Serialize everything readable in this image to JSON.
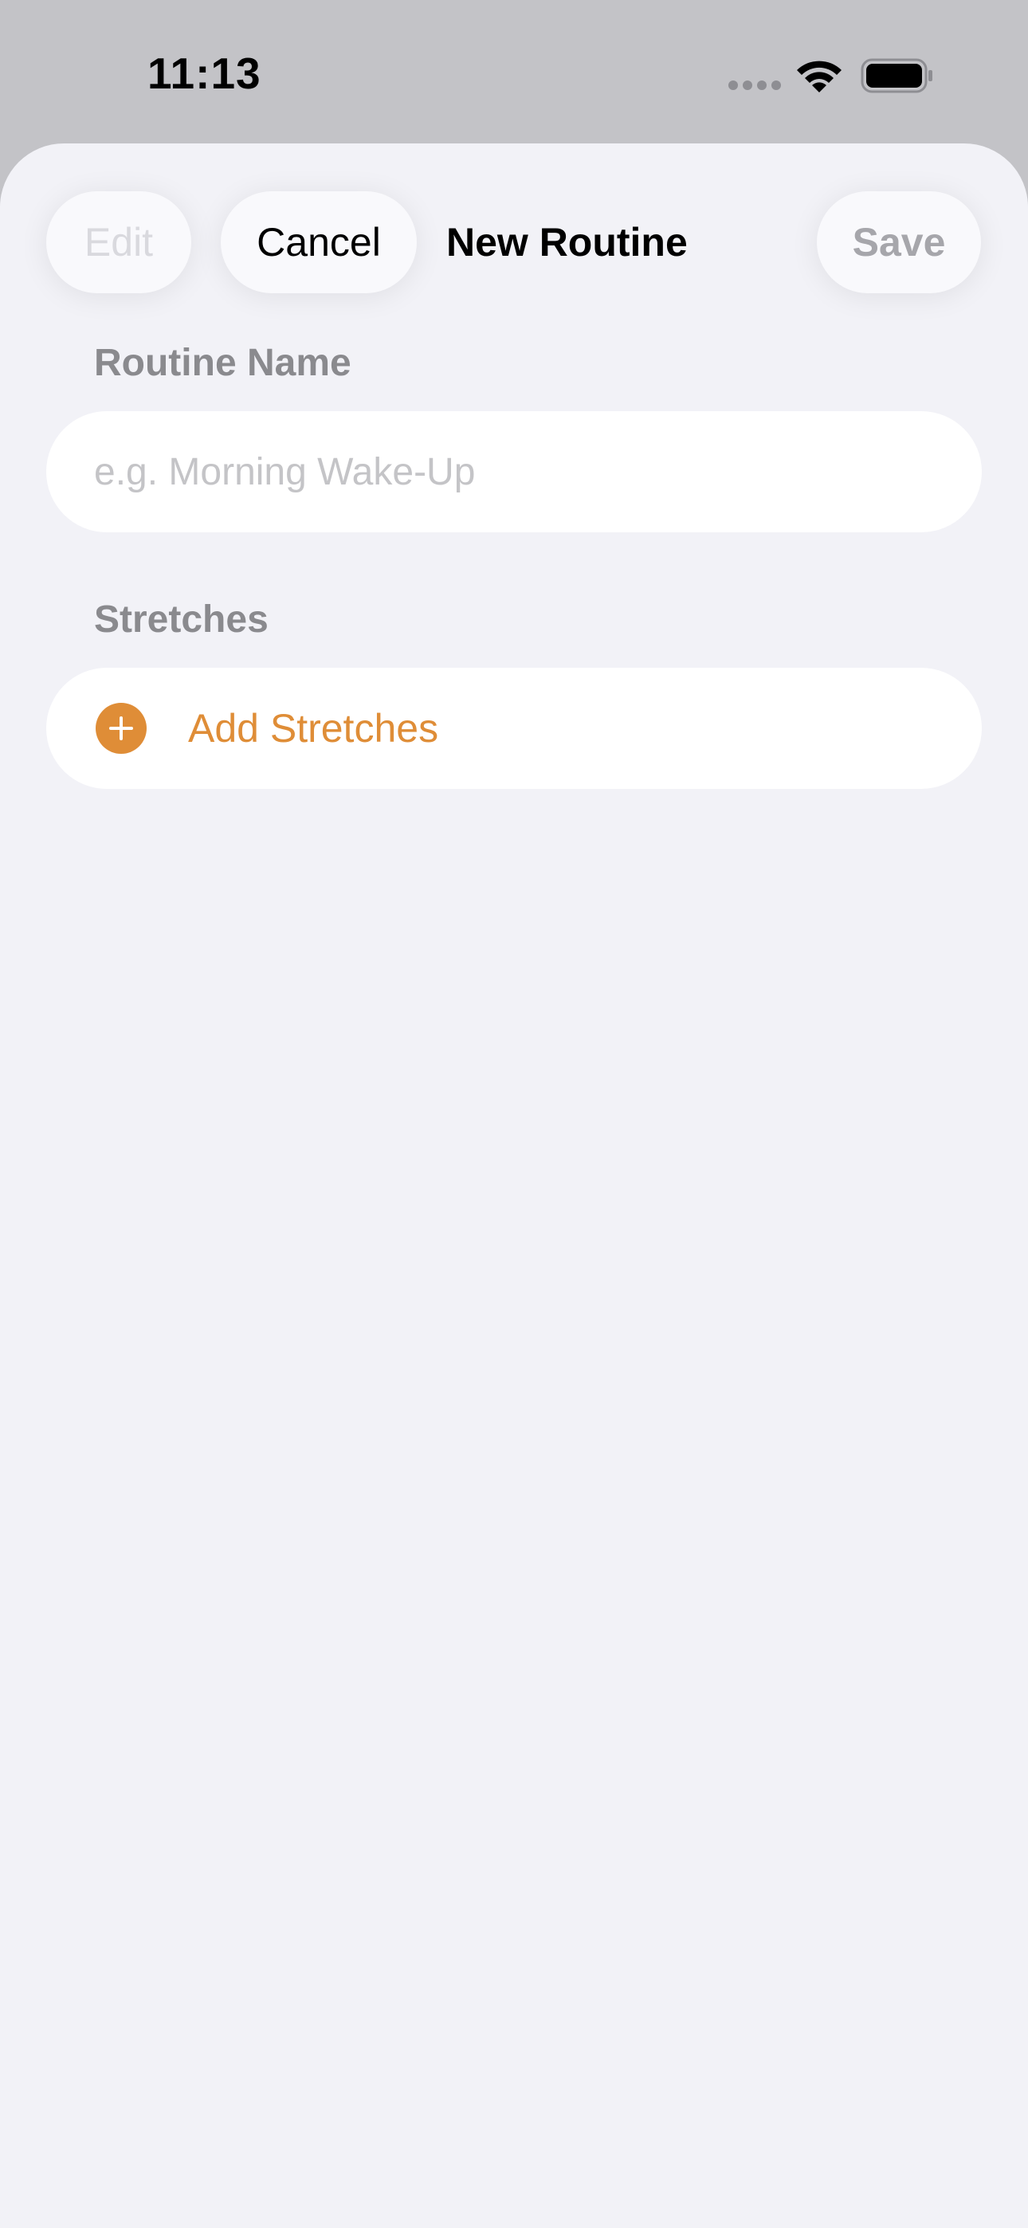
{
  "status_bar": {
    "time": "11:13"
  },
  "colors": {
    "accent": "#DF8D37",
    "background": "#F2F2F7",
    "section_header": "#8A8A8E"
  },
  "nav": {
    "edit_label": "Edit",
    "cancel_label": "Cancel",
    "title": "New Routine",
    "save_label": "Save"
  },
  "routine_name": {
    "header": "Routine Name",
    "placeholder": "e.g. Morning Wake-Up",
    "value": ""
  },
  "stretches": {
    "header": "Stretches",
    "add_label": "Add Stretches",
    "add_icon": "plus-circle-icon"
  }
}
